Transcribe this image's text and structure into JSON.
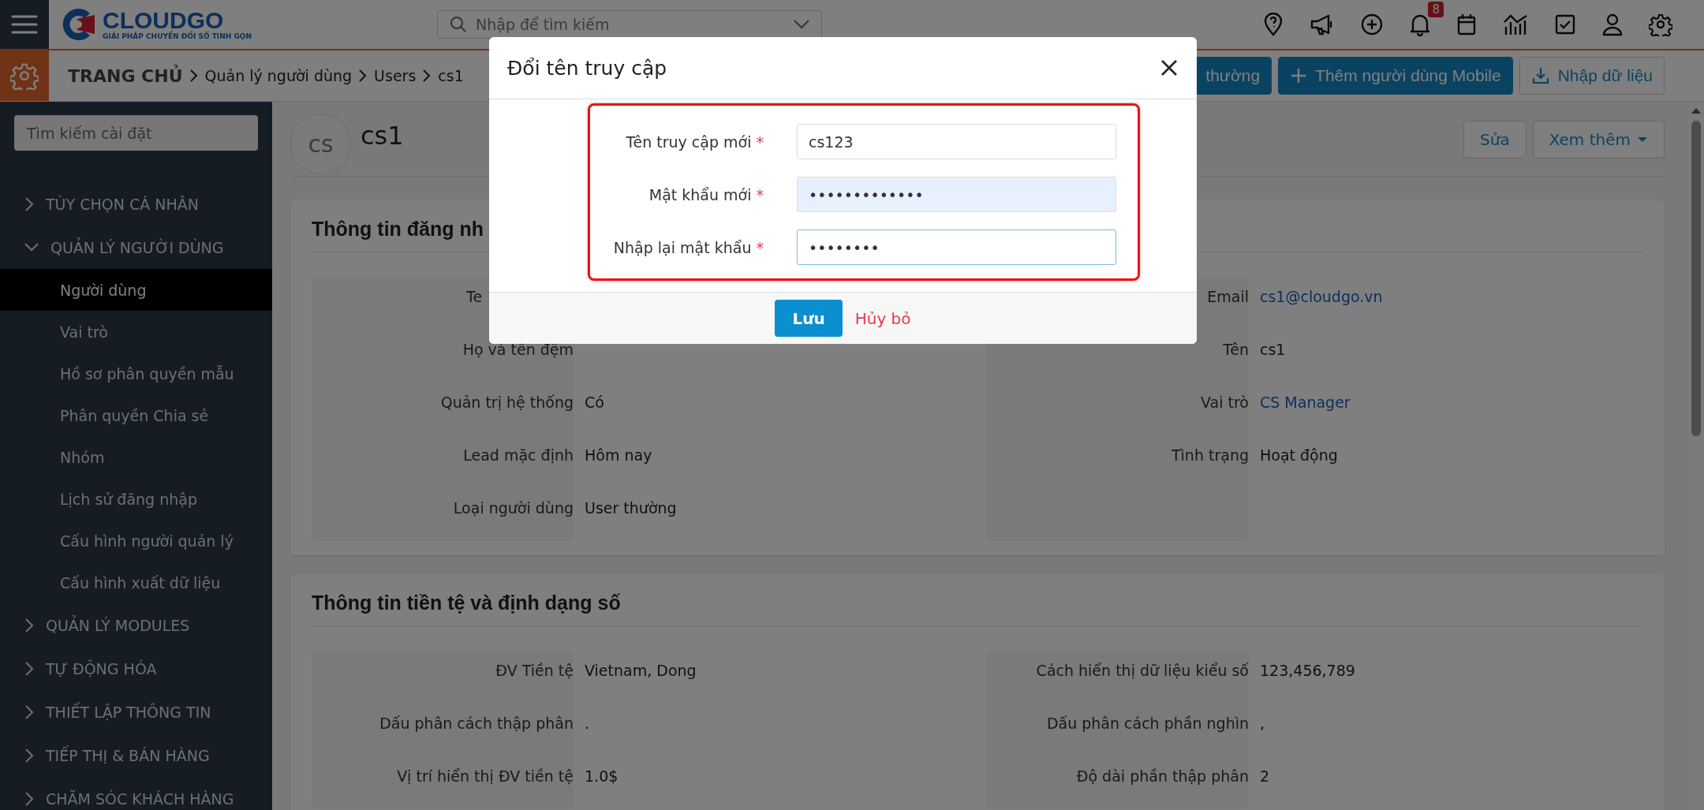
{
  "topbar": {
    "logo": {
      "name": "CLOUDGO",
      "tagline": "GIẢI PHÁP CHUYỂN ĐỔI SỐ TINH GỌN"
    },
    "search": {
      "placeholder": "Nhập để tìm kiếm"
    },
    "notification_count": "8"
  },
  "breadcrumb": {
    "home": "TRANG CHỦ",
    "items": [
      "Quản lý người dùng",
      "Users",
      "cs1"
    ]
  },
  "toolbar_buttons": [
    {
      "label": "thường",
      "kind": "primary"
    },
    {
      "label": "Thêm người dùng Mobile",
      "kind": "add"
    },
    {
      "label": "Nhập dữ liệu",
      "kind": "import"
    }
  ],
  "sidebar": {
    "search": {
      "placeholder": "Tìm kiếm cài đặt"
    },
    "groups": [
      {
        "label": "TÙY CHỌN CÁ NHÂN",
        "expanded": false
      },
      {
        "label": "QUẢN LÝ NGƯỜI DÙNG",
        "expanded": true,
        "children": [
          {
            "label": "Người dùng",
            "selected": true
          },
          {
            "label": "Vai trò",
            "selected": false
          },
          {
            "label": "Hồ sơ phân quyền mẫu",
            "selected": false
          },
          {
            "label": "Phân quyền Chia sẻ",
            "selected": false
          },
          {
            "label": "Nhóm",
            "selected": false
          },
          {
            "label": "Lịch sử đăng nhập",
            "selected": false
          },
          {
            "label": "Cấu hình người quản lý",
            "selected": false
          },
          {
            "label": "Cấu hình xuất dữ liệu",
            "selected": false
          }
        ]
      },
      {
        "label": "QUẢN LÝ MODULES",
        "expanded": false
      },
      {
        "label": "TỰ ĐỘNG HÓA",
        "expanded": false
      },
      {
        "label": "THIẾT LẬP THÔNG TIN",
        "expanded": false
      },
      {
        "label": "TIẾP THỊ & BÁN HÀNG",
        "expanded": false
      },
      {
        "label": "CHĂM SÓC KHÁCH HÀNG",
        "expanded": false
      }
    ]
  },
  "record": {
    "avatar": "cs",
    "title": "cs1",
    "actions": [
      {
        "label": "Sửa",
        "kind": "plain"
      },
      {
        "label": "Xem thêm",
        "kind": "dropdown"
      }
    ]
  },
  "sections": [
    {
      "title": "Thông tin đăng nh",
      "left": [
        {
          "label": "Te",
          "kind": "cut"
        },
        {
          "label": "Họ và tên đệm"
        },
        {
          "label": "Quản trị hệ thống",
          "value": "Có",
          "kind": "text"
        },
        {
          "label": "Lead mặc định",
          "value": "Hôm nay",
          "kind": "text"
        },
        {
          "label": "Loại người dùng",
          "value": "User thường",
          "kind": "text"
        }
      ],
      "right": [
        {
          "label": "Email",
          "value": "cs1@cloudgo.vn",
          "kind": "link"
        },
        {
          "label": "Tên",
          "value": "cs1",
          "kind": "text"
        },
        {
          "label": "Vai trò",
          "value": "CS Manager",
          "kind": "link"
        },
        {
          "label": "Tình trạng",
          "value": "Hoạt động",
          "kind": "text"
        }
      ]
    },
    {
      "title": "Thông tin tiền tệ và định dạng số",
      "left": [
        {
          "label": "ĐV Tiền tệ",
          "value": "Vietnam, Dong",
          "kind": "text"
        },
        {
          "label": "Dấu phân cách thập phân",
          "value": ".",
          "kind": "text"
        },
        {
          "label": "Vị trí hiển thị ĐV tiền tệ",
          "value": "1.0$",
          "kind": "text"
        }
      ],
      "right": [
        {
          "label": "Cách hiển thị dữ liệu kiểu số",
          "value": "123,456,789",
          "kind": "text"
        },
        {
          "label": "Dấu phân cách phần nghìn",
          "value": ",",
          "kind": "text"
        },
        {
          "label": "Độ dài phần thập phân",
          "value": "2",
          "kind": "text"
        }
      ]
    }
  ],
  "modal": {
    "title": "Đổi tên truy cập",
    "fields": [
      {
        "label": "Tên truy cập mới",
        "required_mark": "*",
        "value": "cs123",
        "autofilled": false,
        "focused": false
      },
      {
        "label": "Mật khẩu mới",
        "required_mark": "*",
        "value": "•••••••••••••",
        "autofilled": true,
        "focused": false
      },
      {
        "label": "Nhập lại mật khẩu",
        "required_mark": "*",
        "value": "••••••••",
        "autofilled": false,
        "focused": true
      }
    ],
    "save": "Lưu",
    "cancel": "Hủy bỏ"
  }
}
